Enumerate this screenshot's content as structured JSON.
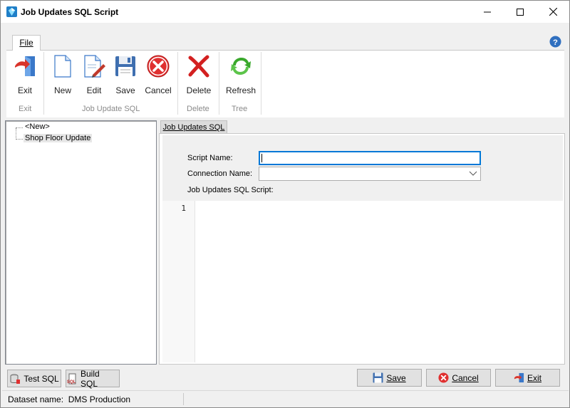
{
  "window": {
    "title": "Job Updates SQL Script"
  },
  "ribbon": {
    "tab_file": "File",
    "buttons": {
      "exit": "Exit",
      "new": "New",
      "edit": "Edit",
      "save": "Save",
      "cancel": "Cancel",
      "delete": "Delete",
      "refresh": "Refresh"
    },
    "groups": {
      "exit": "Exit",
      "job_update_sql": "Job Update SQL",
      "delete": "Delete",
      "tree": "Tree"
    }
  },
  "tree": {
    "items": [
      "<New>",
      "Shop Floor Update"
    ],
    "selected": "Shop Floor Update"
  },
  "pane": {
    "tab": "Job Updates SQL",
    "script_name_label": "Script Name:",
    "script_name_value": "",
    "connection_name_label": "Connection Name:",
    "connection_name_value": "",
    "script_label": "Job Updates SQL Script:",
    "editor_line": "1"
  },
  "bottom": {
    "test_sql": "Test SQL",
    "build_sql": "Build SQL",
    "save": "Save",
    "cancel": "Cancel",
    "exit": "Exit"
  },
  "status": {
    "dataset": "Dataset name:  DMS Production"
  },
  "colors": {
    "accent": "#0078d7",
    "cancel_red": "#e03030",
    "refresh_green": "#3aa82c",
    "help_blue": "#2f6fbf"
  }
}
